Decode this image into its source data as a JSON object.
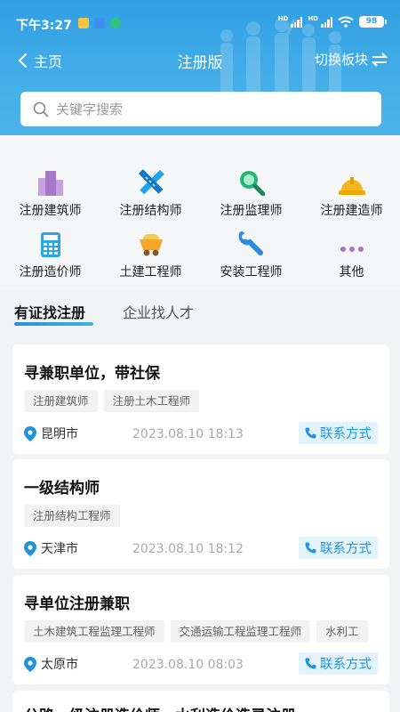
{
  "status_bar": {
    "time": "下午3:27",
    "battery": "98",
    "network_label": "HD"
  },
  "nav": {
    "back_label": "主页",
    "title": "注册版",
    "switch_label": "切换板块"
  },
  "search": {
    "placeholder": "关键字搜索"
  },
  "categories": [
    {
      "label": "注册建筑师",
      "icon": "building-icon",
      "color": "#a678c9"
    },
    {
      "label": "注册结构师",
      "icon": "ruler-pencil-icon",
      "color": "#1fa6e8"
    },
    {
      "label": "注册监理师",
      "icon": "magnifier-icon",
      "color": "#22b573"
    },
    {
      "label": "注册建造师",
      "icon": "hard-hat-icon",
      "color": "#f5b51f"
    },
    {
      "label": "注册造价师",
      "icon": "calculator-icon",
      "color": "#2ba6e6"
    },
    {
      "label": "土建工程师",
      "icon": "mine-cart-icon",
      "color": "#f4a52a"
    },
    {
      "label": "安装工程师",
      "icon": "wrench-icon",
      "color": "#2a8be0"
    },
    {
      "label": "其他",
      "icon": "more-dots-icon",
      "color": "#a678c9"
    }
  ],
  "tabs": [
    {
      "label": "有证找注册",
      "active": true
    },
    {
      "label": "企业找人才",
      "active": false
    }
  ],
  "listings": [
    {
      "title": "寻兼职单位，带社保",
      "tags": [
        "注册建筑师",
        "注册土木工程师"
      ],
      "city": "昆明市",
      "date": "2023.08.10 18:13",
      "contact_label": "联系方式"
    },
    {
      "title": "一级结构师",
      "tags": [
        "注册结构工程师"
      ],
      "city": "天津市",
      "date": "2023.08.10 18:12",
      "contact_label": "联系方式"
    },
    {
      "title": "寻单位注册兼职",
      "tags": [
        "土木建筑工程监理工程师",
        "交通运输工程监理工程师",
        "水利工"
      ],
      "city": "太原市",
      "date": "2023.08.10 08:03",
      "contact_label": "联系方式"
    },
    {
      "title": "公路一级注册造价师，水利造价造灵注册",
      "tags": [],
      "city": "",
      "date": "",
      "contact_label": ""
    }
  ],
  "colors": {
    "header_blue": "#2f9fe3",
    "accent_blue": "#1f93dd",
    "contact_bg": "#e3f3fc",
    "tag_bg": "#f2f2f2",
    "page_bg": "#f2f3f5"
  }
}
